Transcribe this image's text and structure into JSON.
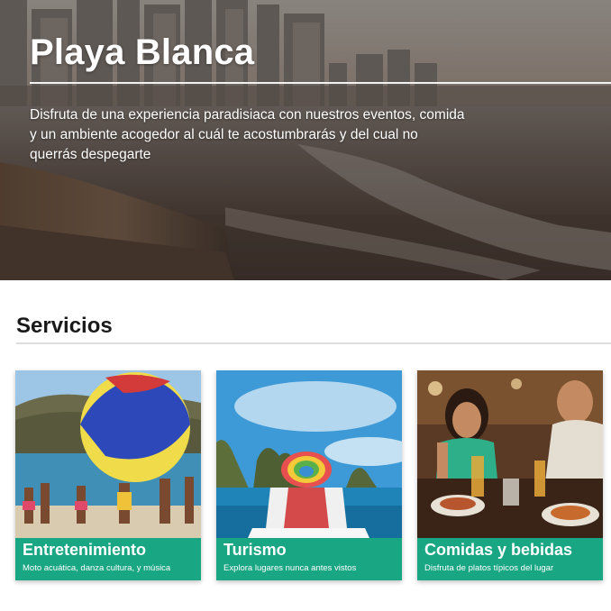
{
  "hero": {
    "title": "Playa Blanca",
    "description": "Disfruta de una experiencia paradisiaca con nuestros eventos, comida y un ambiente acogedor al cuál te acostumbrarás y del cual no querrás despegarte"
  },
  "services": {
    "heading": "Servicios",
    "cards": [
      {
        "title": "Entretenimiento",
        "subtitle": "Moto acuática, danza cultura, y música"
      },
      {
        "title": "Turismo",
        "subtitle": "Explora lugares nunca antes vistos"
      },
      {
        "title": "Comidas y bebidas",
        "subtitle": "Disfruta de platos típicos del lugar"
      }
    ]
  },
  "colors": {
    "caption_bg": "#18a683",
    "text_dark": "#1a1a1a",
    "rule": "#dcdcdc"
  }
}
